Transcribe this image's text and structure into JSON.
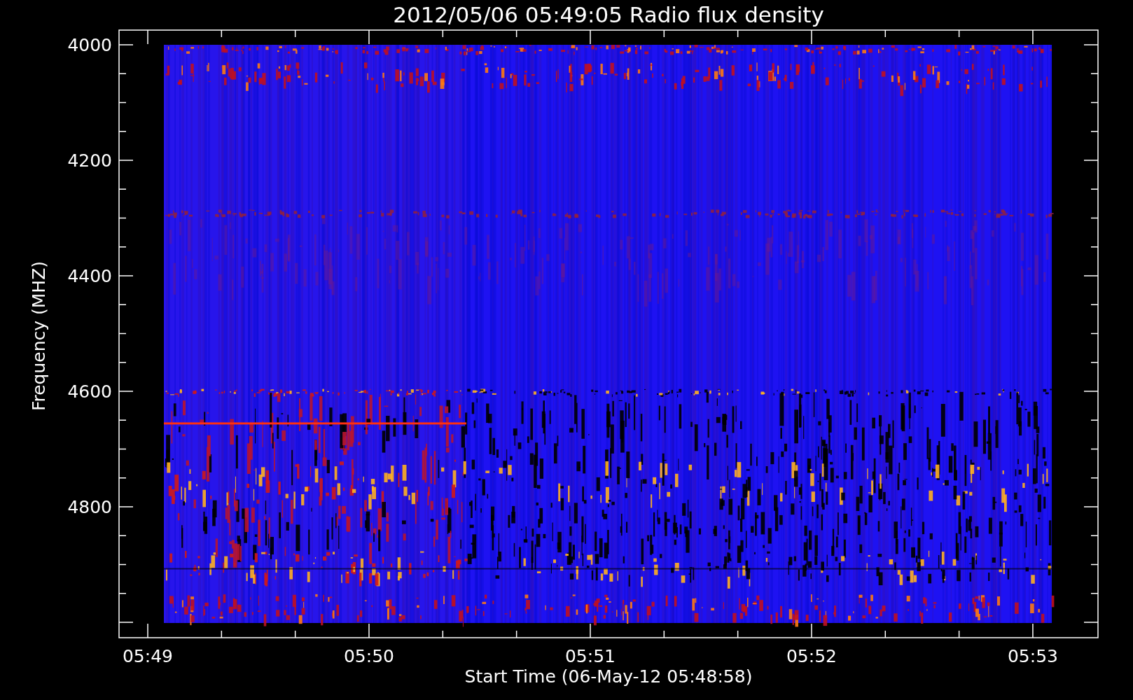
{
  "title": "2012/05/06 05:49:05 Radio flux density",
  "y_axis": {
    "label": "Frequency (MHZ)",
    "ticks": [
      "4000",
      "4200",
      "4400",
      "4600",
      "4800"
    ]
  },
  "x_axis": {
    "label": "Start Time (06-May-12 05:48:58)",
    "ticks": [
      "05:49",
      "05:50",
      "05:51",
      "05:52",
      "05:53"
    ]
  }
}
